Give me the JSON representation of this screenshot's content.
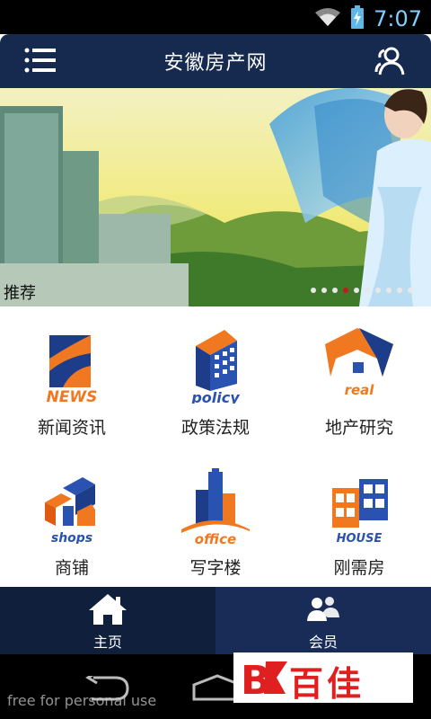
{
  "status": {
    "time": "7:07"
  },
  "header": {
    "title": "安徽房产网"
  },
  "banner": {
    "label": "推荐",
    "dots_total": 10,
    "active_dot": 3
  },
  "grid": {
    "items": [
      {
        "label": "新闻资讯",
        "icon_text": "NEWS",
        "icon": "news-icon"
      },
      {
        "label": "政策法规",
        "icon_text": "policy",
        "icon": "policy-building-icon"
      },
      {
        "label": "地产研究",
        "icon_text": "real",
        "icon": "real-estate-icon"
      },
      {
        "label": "商铺",
        "icon_text": "shops",
        "icon": "shops-icon"
      },
      {
        "label": "写字楼",
        "icon_text": "office",
        "icon": "office-building-icon"
      },
      {
        "label": "刚需房",
        "icon_text": "HOUSE",
        "icon": "house-windows-icon"
      }
    ]
  },
  "tabs": [
    {
      "label": "主页",
      "icon": "home-icon"
    },
    {
      "label": "会员",
      "icon": "members-icon"
    }
  ],
  "watermark": {
    "text": "free for personal use",
    "logo_text": "百佳",
    "logo_prefix": "B"
  }
}
